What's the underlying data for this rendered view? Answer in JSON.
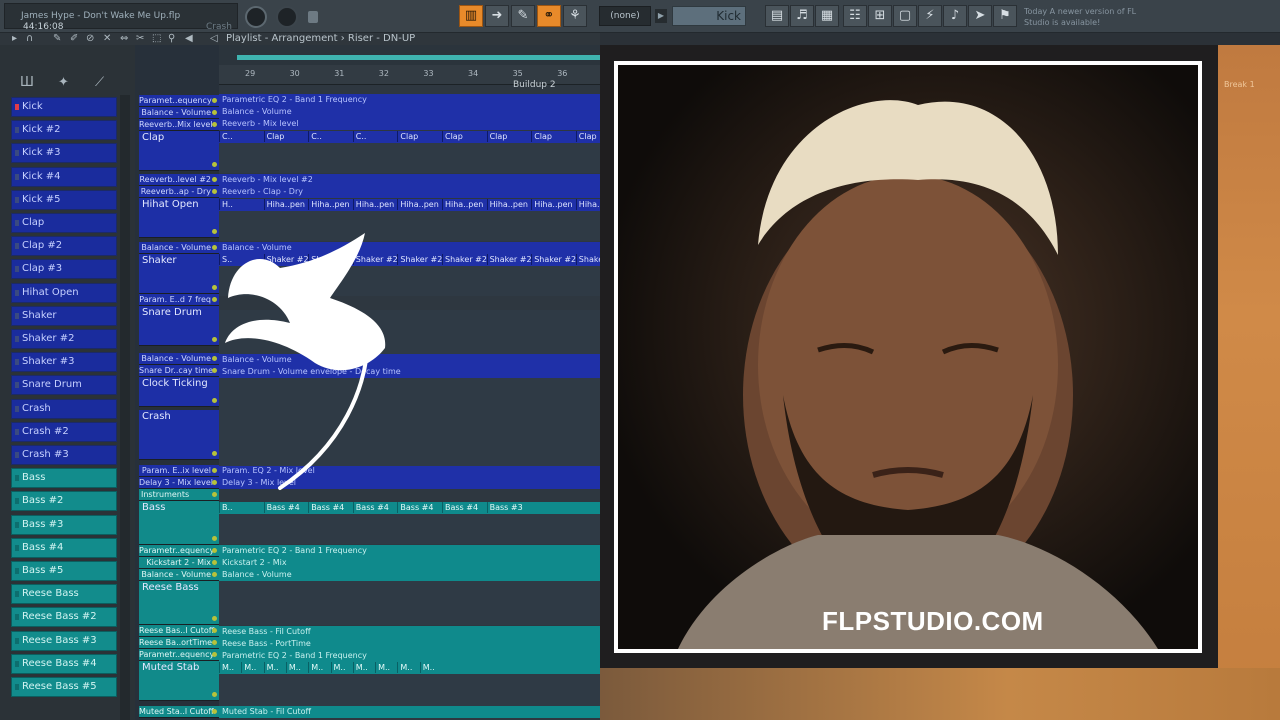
{
  "topbar": {
    "song_title": "James Hype - Don't Wake Me Up.flp",
    "song_time": "44:16:08",
    "hint": "Crash",
    "pattern": "(none)",
    "channel": "Kick",
    "news": "Today  A newer version of FL Studio is available!"
  },
  "toolbar2": {
    "playlist_title": "Playlist - Arrangement  ›  Riser - DN-UP"
  },
  "ruler": {
    "bars": [
      "29",
      "30",
      "31",
      "32",
      "33",
      "34",
      "35",
      "36"
    ],
    "marker": "Buildup 2",
    "right_marker": "Break 1"
  },
  "sidebar": {
    "channels": [
      {
        "label": "Kick",
        "color": "blue",
        "led": "red"
      },
      {
        "label": "Kick #2",
        "color": "blue"
      },
      {
        "label": "Kick #3",
        "color": "blue"
      },
      {
        "label": "Kick #4",
        "color": "blue"
      },
      {
        "label": "Kick #5",
        "color": "blue"
      },
      {
        "label": "Clap",
        "color": "blue"
      },
      {
        "label": "Clap #2",
        "color": "blue"
      },
      {
        "label": "Clap #3",
        "color": "blue"
      },
      {
        "label": "Hihat Open",
        "color": "blue"
      },
      {
        "label": "Shaker",
        "color": "blue"
      },
      {
        "label": "Shaker #2",
        "color": "blue"
      },
      {
        "label": "Shaker #3",
        "color": "blue"
      },
      {
        "label": "Snare Drum",
        "color": "blue"
      },
      {
        "label": "Crash",
        "color": "blue"
      },
      {
        "label": "Crash #2",
        "color": "blue"
      },
      {
        "label": "Crash #3",
        "color": "blue"
      },
      {
        "label": "Bass",
        "color": "teal"
      },
      {
        "label": "Bass #2",
        "color": "teal"
      },
      {
        "label": "Bass #3",
        "color": "teal"
      },
      {
        "label": "Bass #4",
        "color": "teal"
      },
      {
        "label": "Bass #5",
        "color": "teal"
      },
      {
        "label": "Reese Bass",
        "color": "teal"
      },
      {
        "label": "Reese Bass #2",
        "color": "teal"
      },
      {
        "label": "Reese Bass #3",
        "color": "teal"
      },
      {
        "label": "Reese Bass #4",
        "color": "teal"
      },
      {
        "label": "Reese Bass #5",
        "color": "teal"
      }
    ]
  },
  "tracks": [
    {
      "label": "Paramet..equency",
      "kind": "auto"
    },
    {
      "label": "Balance - Volume",
      "kind": "auto"
    },
    {
      "label": "Reeverb..Mix level",
      "kind": "auto"
    },
    {
      "label": "Clap",
      "kind": "big"
    },
    {
      "label": "Reeverb..level #2",
      "kind": "auto"
    },
    {
      "label": "Reeverb..ap - Dry",
      "kind": "auto"
    },
    {
      "label": "Hihat Open",
      "kind": "big"
    },
    {
      "label": "Balance - Volume",
      "kind": "auto"
    },
    {
      "label": "Shaker",
      "kind": "big"
    },
    {
      "label": "Param. E..d 7 freq",
      "kind": "auto"
    },
    {
      "label": "Snare Drum",
      "kind": "big"
    },
    {
      "label": "Balance - Volume",
      "kind": "auto"
    },
    {
      "label": "Snare Dr..cay time",
      "kind": "auto"
    },
    {
      "label": "Clock Ticking",
      "kind": "big"
    },
    {
      "label": "Crash",
      "kind": "big"
    },
    {
      "label": "Param. E..ix level",
      "kind": "auto"
    },
    {
      "label": "Delay 3 - Mix level",
      "kind": "auto"
    },
    {
      "label": "Instruments",
      "kind": "group"
    },
    {
      "label": "Bass",
      "kind": "big"
    },
    {
      "label": "Parametr..equency",
      "kind": "auto"
    },
    {
      "label": "Kickstart 2 - Mix",
      "kind": "auto"
    },
    {
      "label": "Balance - Volume",
      "kind": "auto"
    },
    {
      "label": "Reese Bass",
      "kind": "big"
    },
    {
      "label": "Reese Bas..l Cutoff",
      "kind": "auto"
    },
    {
      "label": "Reese Ba..ortTime",
      "kind": "auto"
    },
    {
      "label": "Parametr..equency",
      "kind": "auto"
    },
    {
      "label": "Muted Stab",
      "kind": "big"
    },
    {
      "label": "Muted Sta..l Cutoff",
      "kind": "auto"
    }
  ],
  "lanes": {
    "auto": [
      "Parametric EQ 2 - Band 1 Frequency",
      "Balance - Volume",
      "Reeverb - Mix level",
      "Reeverb - Mix level #2",
      "Reeverb - Clap - Dry",
      "Balance - Volume",
      "Balance - Volume",
      "Snare Drum - Volume envelope - Decay time",
      "Param. EQ 2 - Mix level",
      "Delay 3 - Mix level",
      "Parametric EQ 2 - Band 1 Frequency",
      "Kickstart 2 - Mix",
      "Balance - Volume",
      "Reese Bass - Fil Cutoff",
      "Reese Bass - PortTime",
      "Parametric EQ 2 - Band 1 Frequency",
      "Muted Stab - Fil Cutoff"
    ],
    "clap_clips": [
      "C..",
      "Clap",
      "C..",
      "C..",
      "Clap",
      "Clap",
      "Clap",
      "Clap",
      "Clap",
      "Clap"
    ],
    "hihat_clips": [
      "H..",
      "Hiha..pen",
      "Hiha..pen",
      "Hiha..pen",
      "Hiha..pen",
      "Hiha..pen",
      "Hiha..pen",
      "Hiha..pen",
      "Hiha..pen"
    ],
    "shaker_clips": [
      "S..",
      "Shaker #2",
      "Shaker #2",
      "Shaker #2",
      "Shaker #2",
      "Shaker #2",
      "Shaker #2",
      "Shaker #2",
      "Shaker #2"
    ],
    "bass_clips": [
      "B..",
      "Bass #4",
      "Bass #4",
      "Bass #4",
      "Bass #4",
      "Bass #4",
      "Bass #3"
    ],
    "stab_clips": [
      "M..",
      "M..",
      "M..",
      "M..",
      "M..",
      "M..",
      "M..",
      "M..",
      "M..",
      "M.."
    ]
  },
  "overlay": {
    "watermark": "FLPSTUDIO.COM"
  },
  "colors": {
    "accent": "#e88a2a",
    "blue_track": "#1f30a8",
    "teal_track": "#0f8a8c"
  }
}
